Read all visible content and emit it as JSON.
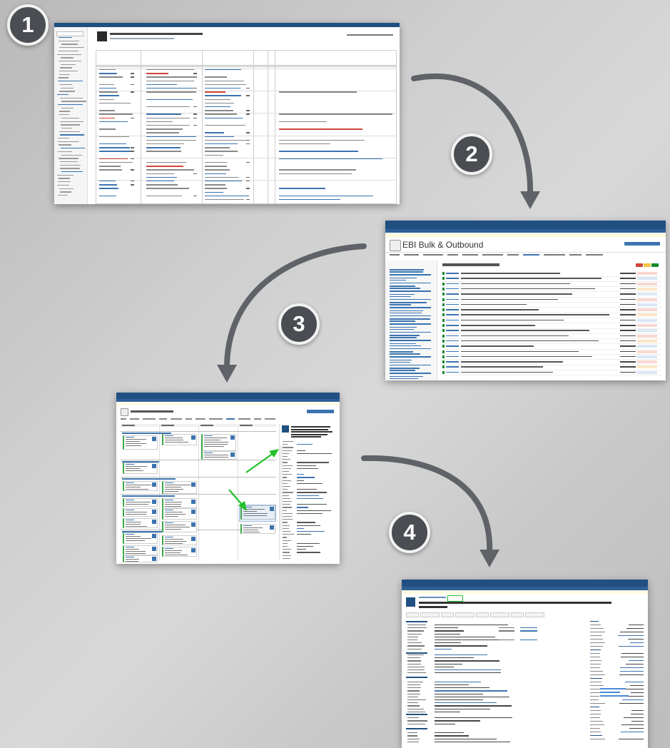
{
  "steps": [
    {
      "number": "1",
      "label": "Step 1 badge"
    },
    {
      "number": "2",
      "label": "Step 2 badge"
    },
    {
      "number": "3",
      "label": "Step 3 badge"
    },
    {
      "number": "4",
      "label": "Step 4 badge"
    }
  ],
  "screens": {
    "one": {
      "kind": "structure-table"
    },
    "two": {
      "kind": "jira-board-backlog",
      "board_title": "EBI Bulk & Outbound"
    },
    "three": {
      "kind": "jira-board-work",
      "board_title": "EBI Bulk & Outbound"
    },
    "four": {
      "kind": "jira-issue-view"
    }
  },
  "colors": {
    "arrow": "#5f6368",
    "badge_bg": "#4a4d51",
    "jira_header": "#205081",
    "highlight_green": "#22c02a"
  }
}
